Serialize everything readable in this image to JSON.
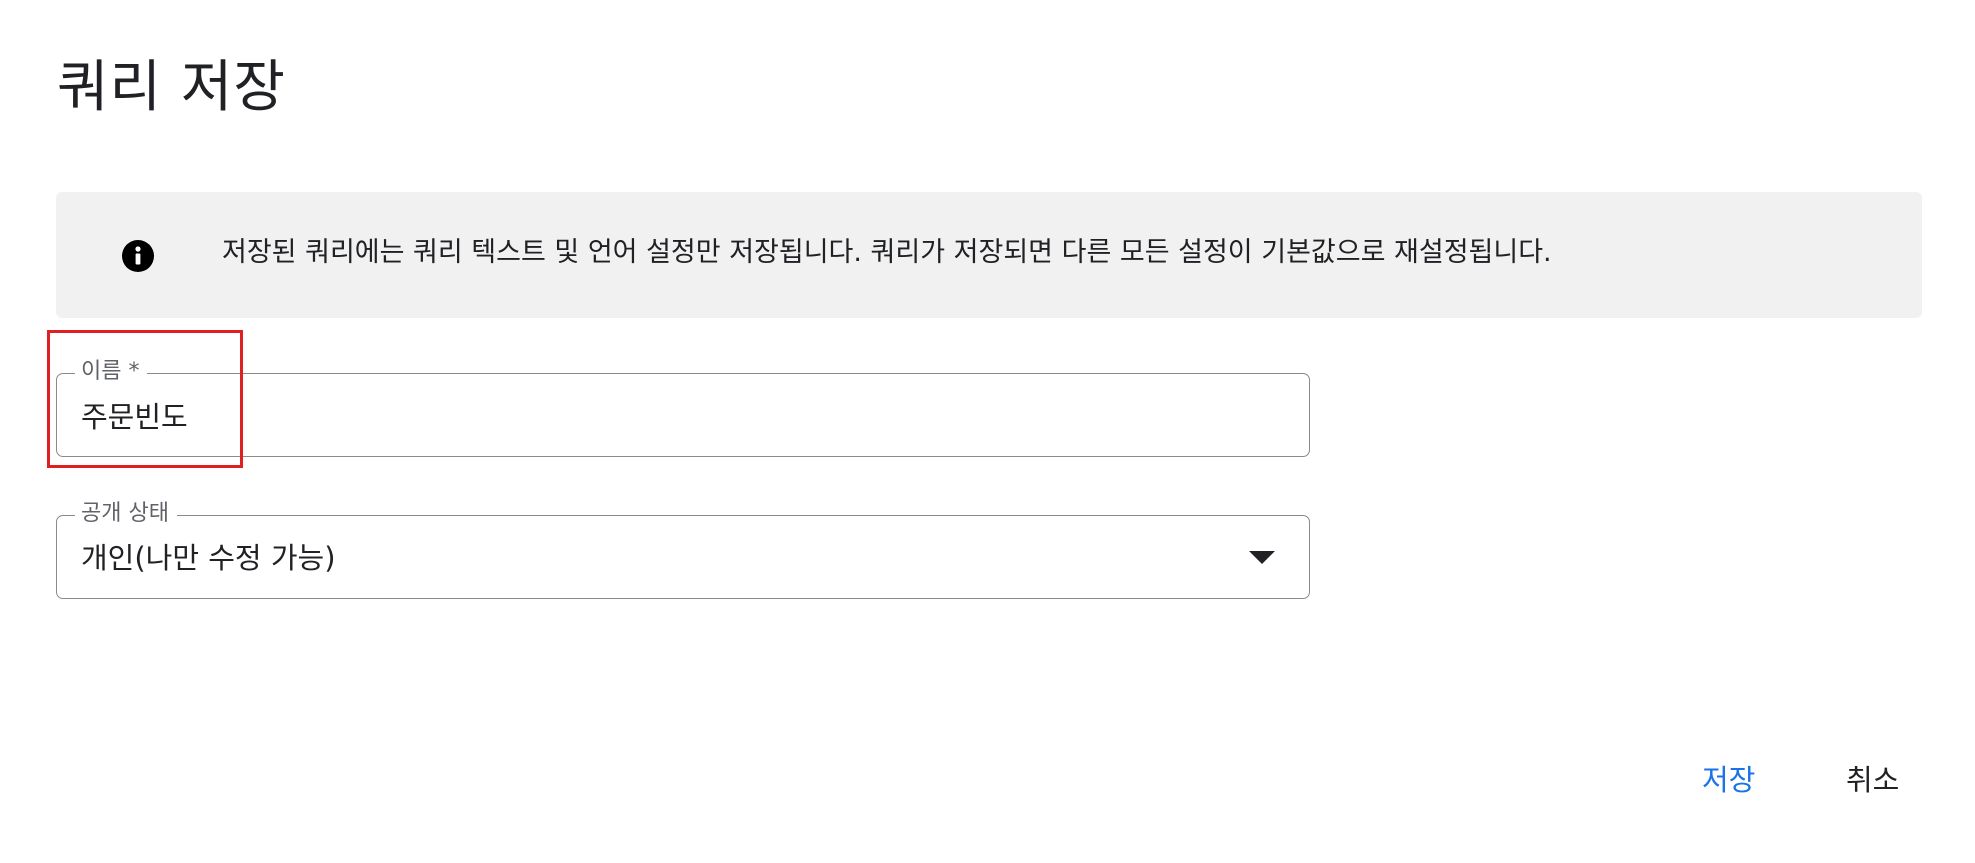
{
  "dialog": {
    "title": "쿼리 저장"
  },
  "info_banner": {
    "icon": "info-icon",
    "message": "저장된 쿼리에는 쿼리 텍스트 및 언어 설정만 저장됩니다. 쿼리가 저장되면 다른 모든 설정이 기본값으로 재설정됩니다."
  },
  "name_field": {
    "label": "이름 *",
    "value": "주문빈도"
  },
  "visibility_field": {
    "label": "공개 상태",
    "selected": "개인(나만 수정 가능)",
    "icon": "dropdown-arrow-icon"
  },
  "actions": {
    "save_label": "저장",
    "cancel_label": "취소"
  },
  "colors": {
    "accent": "#1a73e8",
    "banner_bg": "#f1f1f1",
    "highlight": "#e02020"
  }
}
